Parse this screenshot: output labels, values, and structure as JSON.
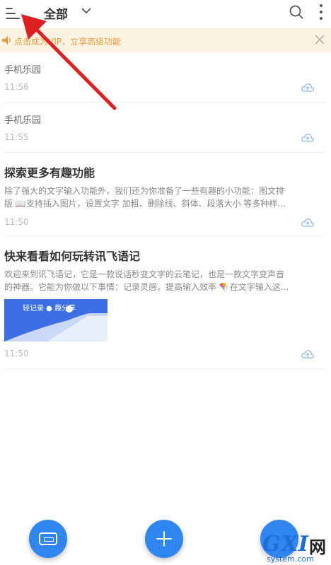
{
  "header": {
    "folder_title": "全部",
    "icons": [
      "menu-icon",
      "chevron-down-icon",
      "search-icon",
      "more-icon"
    ]
  },
  "vip_banner": {
    "text": "点击成为VIP，立享高级功能",
    "icon": "speaker-icon",
    "close_icon": "close-icon",
    "color": "#e8993b"
  },
  "notes": [
    {
      "title": "手机乐园",
      "time": "11:56"
    },
    {
      "title": "手机乐园",
      "time": "11:55"
    },
    {
      "title": "探索更多有趣功能",
      "excerpt_line1": "除了强大的文字输入功能外，我们还为你准备了一些有趣的小功能：图文排",
      "excerpt_line2": "版 📖支持插入图片，设置文字 加粗、删除线、斜体、段落大小 等多种样...",
      "time": "11:50"
    },
    {
      "title": "快来看看如何玩转讯飞语记",
      "excerpt_line1": "欢迎来到讯飞语记，它是一款说话秒变文字的云笔记，也是一款文字变声音",
      "excerpt_line2": "的神器。它能为你做以下事情：记录灵感，提高输入效率 🪁在文字输入这...",
      "image_caption": "轻记录 ● 趣分享",
      "time": "11:50"
    }
  ],
  "fabs": [
    "keyboard-icon",
    "plus-icon"
  ],
  "watermark": {
    "brand": "GXI",
    "net": "网",
    "domain": "system.com"
  },
  "colors": {
    "accent": "#2f86f0",
    "annotation": "#e02020",
    "banner_bg": "#fdf3e3"
  }
}
